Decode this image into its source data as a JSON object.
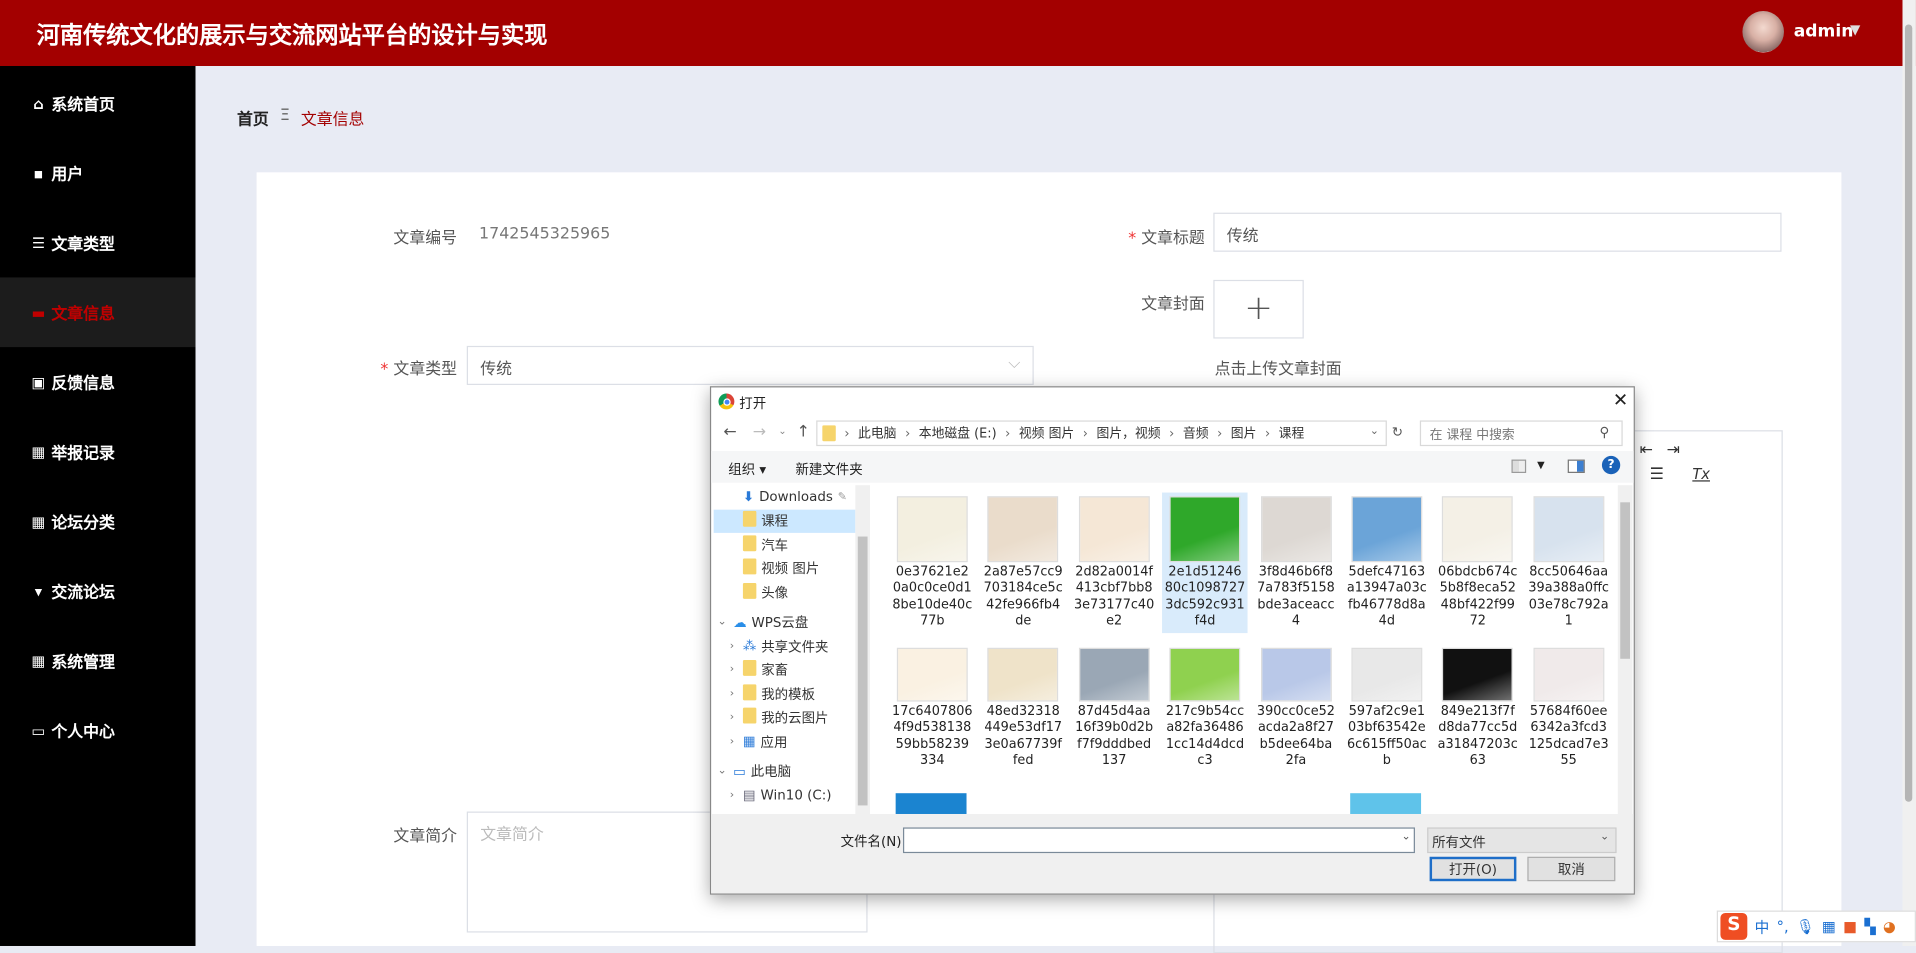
{
  "header": {
    "title": "河南传统文化的展示与交流网站平台的设计与实现",
    "user": "admin"
  },
  "sidebar": {
    "items": [
      {
        "label": "系统首页",
        "icon": "home-icon",
        "glyph": "⌂"
      },
      {
        "label": "用户",
        "icon": "chat-icon",
        "glyph": "▪"
      },
      {
        "label": "文章类型",
        "icon": "list-icon",
        "glyph": "☰"
      },
      {
        "label": "文章信息",
        "icon": "briefcase-icon",
        "glyph": "▬",
        "active": true
      },
      {
        "label": "反馈信息",
        "icon": "feedback-icon",
        "glyph": "▣"
      },
      {
        "label": "举报记录",
        "icon": "grid-icon",
        "glyph": "▦"
      },
      {
        "label": "论坛分类",
        "icon": "grid-icon",
        "glyph": "▦"
      },
      {
        "label": "交流论坛",
        "icon": "comment-icon",
        "glyph": "▾"
      },
      {
        "label": "系统管理",
        "icon": "grid-icon",
        "glyph": "▦"
      },
      {
        "label": "个人中心",
        "icon": "card-icon",
        "glyph": "▭"
      }
    ]
  },
  "breadcrumb": {
    "home": "首页",
    "sep": "Ξ",
    "current": "文章信息"
  },
  "form": {
    "id_label": "文章编号",
    "id_value": "1742545325965",
    "title_label": "文章标题",
    "title_value": "传统",
    "cover_label": "文章封面",
    "cover_hint": "点击上传文章封面",
    "type_label": "文章类型",
    "type_value": "传统",
    "intro_label": "文章简介",
    "intro_placeholder": "文章简介"
  },
  "dialog": {
    "title": "打开",
    "path": [
      "此电脑",
      "本地磁盘 (E:)",
      "视频 图片",
      "图片，视频",
      "音频",
      "图片",
      "课程"
    ],
    "search_placeholder": "在 课程 中搜索",
    "organize": "组织 ▾",
    "new_folder": "新建文件夹",
    "nav": [
      {
        "label": "Downloads",
        "type": "download",
        "indent": 1,
        "pin": true
      },
      {
        "label": "课程",
        "type": "folder",
        "indent": 1,
        "selected": true
      },
      {
        "label": "汽车",
        "type": "folder",
        "indent": 1
      },
      {
        "label": "视频 图片",
        "type": "folder",
        "indent": 1
      },
      {
        "label": "头像",
        "type": "folder",
        "indent": 1
      },
      {
        "label": "WPS云盘",
        "type": "cloud",
        "indent": 0,
        "expanded": true
      },
      {
        "label": "共享文件夹",
        "type": "share",
        "indent": 1
      },
      {
        "label": "家畜",
        "type": "folder",
        "indent": 1
      },
      {
        "label": "我的模板",
        "type": "folder",
        "indent": 1
      },
      {
        "label": "我的云图片",
        "type": "folder",
        "indent": 1
      },
      {
        "label": "应用",
        "type": "apps",
        "indent": 1
      },
      {
        "label": "此电脑",
        "type": "pc",
        "indent": 0,
        "expanded": true
      },
      {
        "label": "Win10 (C:)",
        "type": "drive",
        "indent": 1
      }
    ],
    "files": [
      {
        "name": "0e37621e20a0c0ce0d18be10de40c77b",
        "color": "#f3efe0"
      },
      {
        "name": "2a87e57cc9703184ce5c42fe966fb4de",
        "color": "#eadccb"
      },
      {
        "name": "2d82a0014f413cbf7bb83e73177c40e2",
        "color": "#f5e7d6"
      },
      {
        "name": "2e1d5124680c10987273dc592c931f4d",
        "color": "#2fa82a",
        "selected": true
      },
      {
        "name": "3f8d46b6f87a783f5158bde3aceacc4",
        "color": "#ddd8d3"
      },
      {
        "name": "5defc47163a13947a03cfb46778d8a4d",
        "color": "#6ba4d8"
      },
      {
        "name": "06bdcb674c5b8f8eca5248bf422f9972",
        "color": "#f4f0e6"
      },
      {
        "name": "8cc50646aa39a388a0ffc03e78c792a1",
        "color": "#d7e2ee"
      },
      {
        "name": "17c64078064f9d53813859bb58239334",
        "color": "#faf1e2"
      },
      {
        "name": "48ed32318449e53df173e0a67739ffed",
        "color": "#efe3c9"
      },
      {
        "name": "87d45d4aa16f39b0d2bf7f9dddbed137",
        "color": "#9aa7b5"
      },
      {
        "name": "217c9b54cca82fa364861cc14d4dcdc3",
        "color": "#8fd14f"
      },
      {
        "name": "390cc0ce52acda2a8f27b5dee64ba2fa",
        "color": "#b9c8e8"
      },
      {
        "name": "597af2c9e103bf63542e6c615ff50acb",
        "color": "#e8e8e8"
      },
      {
        "name": "849e213f7fd8da77cc5da31847203c63",
        "color": "#111111"
      },
      {
        "name": "57684f60ee6342a3fcd3125dcad7e355",
        "color": "#f0eaea"
      }
    ],
    "filename_label": "文件名(N):",
    "filename_value": "",
    "filter": "所有文件",
    "open": "打开(O)",
    "cancel": "取消"
  },
  "ime": {
    "mode": "中",
    "punct": "°,"
  },
  "colors": {
    "header": "#a30000",
    "active": "#c00000",
    "sidebar": "#000000"
  }
}
